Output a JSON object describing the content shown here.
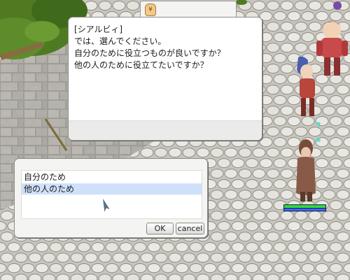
{
  "npc_dialog": {
    "speaker": "[シアルビィ]",
    "lines": [
      "では、選んでください。",
      "自分のために役立つものが良いですか？",
      "他の人のために役立てたいですか？"
    ]
  },
  "choice_menu": {
    "options": [
      "自分のため",
      "他の人のため"
    ],
    "selected_index": 1,
    "ok_label": "OK",
    "cancel_label": "cancel"
  },
  "player_status": {
    "hp_fraction": 1.0,
    "sp_fraction": 1.0
  }
}
